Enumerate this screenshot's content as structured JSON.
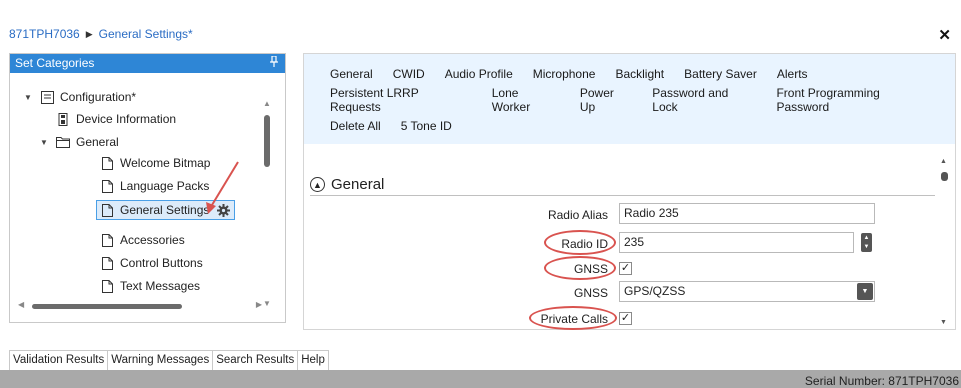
{
  "breadcrumb": {
    "device": "871TPH7036",
    "page": "General Settings*"
  },
  "left_panel": {
    "title": "Set Categories",
    "tree": {
      "configuration": "Configuration*",
      "device_information": "Device Information",
      "general": "General",
      "welcome_bitmap": "Welcome Bitmap",
      "language_packs": "Language Packs",
      "general_settings": "General Settings",
      "accessories": "Accessories",
      "control_buttons": "Control Buttons",
      "text_messages": "Text Messages"
    }
  },
  "tabs": {
    "row1": [
      "General",
      "CWID",
      "Audio Profile",
      "Microphone",
      "Backlight",
      "Battery Saver",
      "Alerts"
    ],
    "row2": [
      "Persistent LRRP Requests",
      "Lone Worker",
      "Power Up",
      "Password and Lock",
      "Front Programming Password"
    ],
    "row3": [
      "Delete All",
      "5 Tone ID"
    ]
  },
  "section": {
    "title": "General"
  },
  "form": {
    "radio_alias": {
      "label": "Radio Alias",
      "value": "Radio 235"
    },
    "radio_id": {
      "label": "Radio ID",
      "value": "235"
    },
    "gnss_enabled": {
      "label": "GNSS",
      "checked": "✓"
    },
    "gnss_mode": {
      "label": "GNSS",
      "value": "GPS/QZSS"
    },
    "private_calls": {
      "label": "Private Calls",
      "checked": "✓"
    }
  },
  "bottom_tabs": [
    "Validation Results",
    "Warning Messages",
    "Search Results",
    "Help"
  ],
  "status": {
    "serial": "Serial Number: 871TPH7036"
  },
  "colors": {
    "accent": "#2e86d6",
    "tabs_bg": "#e9f4ff",
    "annotation": "#d9534f"
  }
}
